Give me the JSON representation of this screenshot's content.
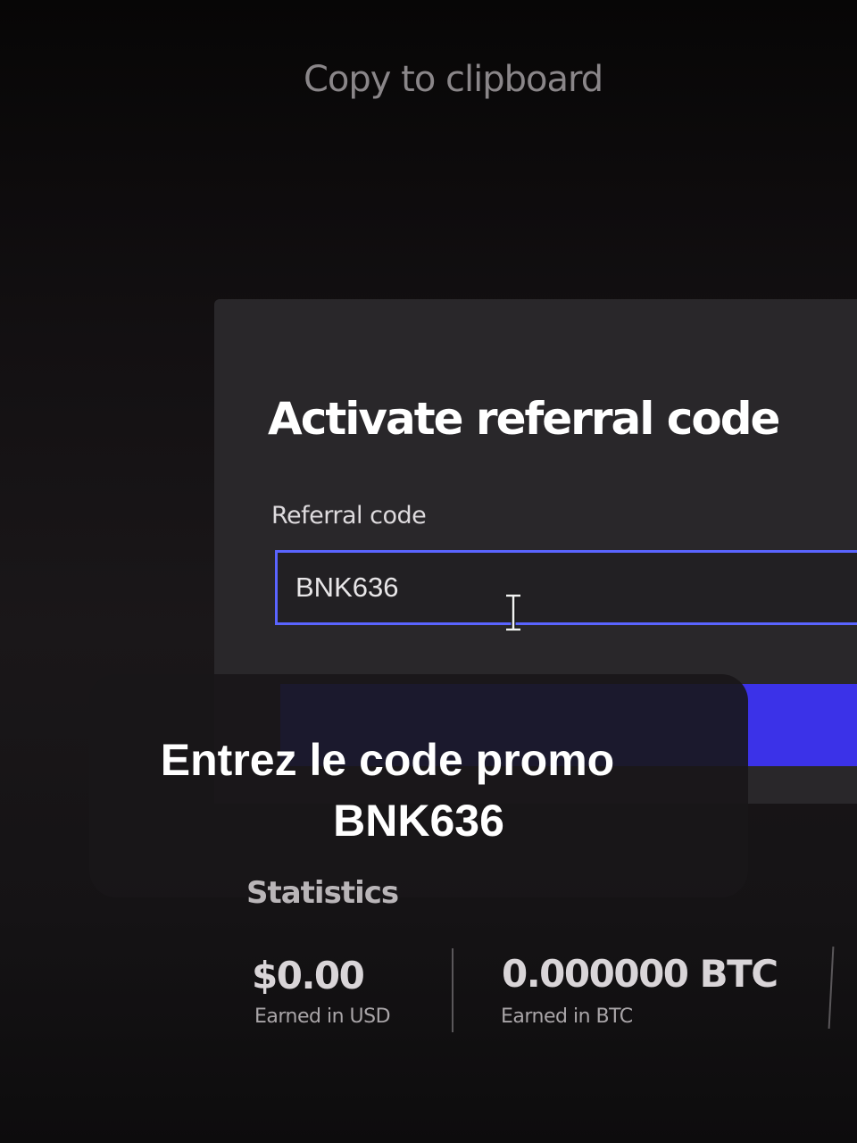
{
  "background_hint": {
    "copy_to_clipboard": "Copy to clipboard"
  },
  "modal": {
    "title": "Activate referral code",
    "field_label": "Referral code",
    "field_value": "BNK636",
    "submit_color": "#3b32e8"
  },
  "caption": {
    "line1": "Entrez le code promo",
    "line2": "BNK636"
  },
  "statistics": {
    "heading": "Statistics",
    "items": [
      {
        "value": "$0.00",
        "label": "Earned in USD"
      },
      {
        "value": "0.000000 BTC",
        "label": "Earned in BTC"
      }
    ]
  },
  "colors": {
    "accent": "#3b32e8",
    "input_border": "#5a64ff",
    "modal_bg": "#29272a"
  },
  "icons": {
    "cursor": "text-cursor-icon"
  }
}
